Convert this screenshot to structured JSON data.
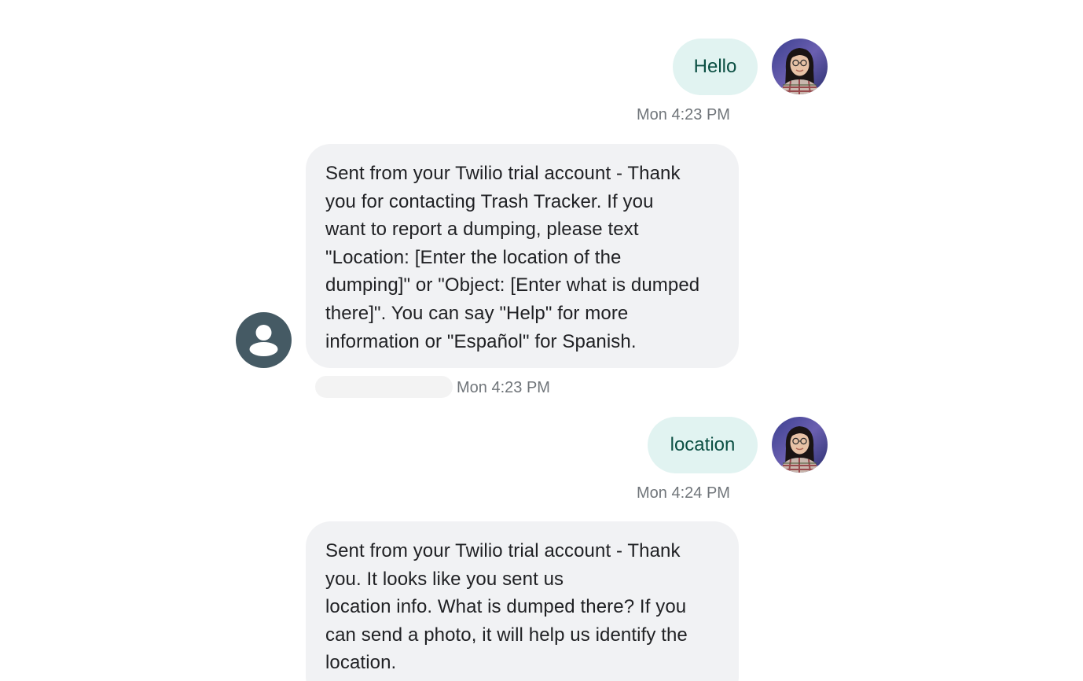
{
  "messages": [
    {
      "type": "outgoing",
      "text": "Hello",
      "timestamp": "Mon 4:23 PM"
    },
    {
      "type": "incoming",
      "text": "Sent from your Twilio trial account - Thank\nyou for contacting Trash Tracker. If you\nwant to report a dumping, please text\n\"Location: [Enter the location of the\ndumping]\" or \"Object: [Enter what is dumped\nthere]\". You can say \"Help\" for more\ninformation or \"Español\" for Spanish.",
      "timestamp": "Mon 4:23 PM"
    },
    {
      "type": "outgoing",
      "text": "location",
      "timestamp": "Mon 4:24 PM"
    },
    {
      "type": "incoming",
      "text": "Sent from your Twilio trial account - Thank\nyou. It looks like you sent us\nlocation info. What is dumped there? If you\ncan send a photo, it will help us identify the\nlocation."
    }
  ],
  "icons": {
    "user_avatar": "user-photo-avatar-icon",
    "contact_avatar": "person-icon"
  },
  "colors": {
    "outgoing_bubble": "#e1f3f1",
    "outgoing_text": "#0b4f43",
    "incoming_bubble": "#f1f2f4",
    "incoming_text": "#202124",
    "timestamp": "#70757a",
    "contact_avatar": "#455a64"
  }
}
